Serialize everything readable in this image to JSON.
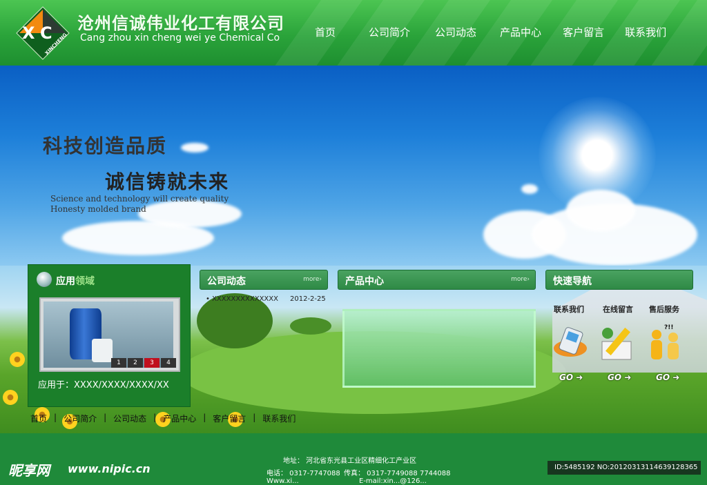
{
  "header": {
    "company_cn": "沧州信诚伟业化工有限公司",
    "company_en": "Cang zhou xin cheng wei ye Chemical Co",
    "logo_text": "XINCHENG",
    "nav": [
      "首页",
      "公司简介",
      "公司动态",
      "产品中心",
      "客户留言",
      "联系我们"
    ]
  },
  "banner": {
    "slogan_line1": "科技创造品质",
    "slogan_line2": "诚信铸就未来",
    "slogan_en_line1": "Science and technology will create quality",
    "slogan_en_line2": "Honesty molded brand"
  },
  "application": {
    "title_main": "应用",
    "title_highlight": "领域",
    "pager": [
      "1",
      "2",
      "3",
      "4"
    ],
    "active_page": "3",
    "usage_text": "应用于：XXXX/XXXX/XXXX/XX"
  },
  "news": {
    "title": "公司动态",
    "more": "more›",
    "items": [
      {
        "title": "XXXXXXXXXXXXXX",
        "date": "2012-2-25"
      }
    ]
  },
  "products": {
    "title": "产品中心",
    "more": "more›"
  },
  "quick_nav": {
    "title": "快速导航",
    "items": [
      {
        "label": "联系我们",
        "go": "GO"
      },
      {
        "label": "在线留言",
        "go": "GO"
      },
      {
        "label": "售后服务",
        "go": "GO"
      }
    ],
    "badge": "?!!"
  },
  "bottom_nav": [
    "首页",
    "公司简介",
    "公司动态",
    "产品中心",
    "客户留言",
    "联系我们"
  ],
  "footer": {
    "address": "地址：  河北省东光县工业区精细化工产业区",
    "tel": "电话：  0317-7747088",
    "fax": "传真：  0317-7749088  7744088",
    "cut_line_a": "Www.xi...",
    "cut_line_b": "E-mail:xin...@126..."
  },
  "watermark": {
    "logo": "昵享网",
    "url": "www.nipic.cn",
    "id": "ID:5485192 NO:20120313114639128365"
  },
  "colors": {
    "brand_green": "#1f8a3a",
    "header_green": "#2aa33a",
    "active_red": "#c0101e"
  }
}
